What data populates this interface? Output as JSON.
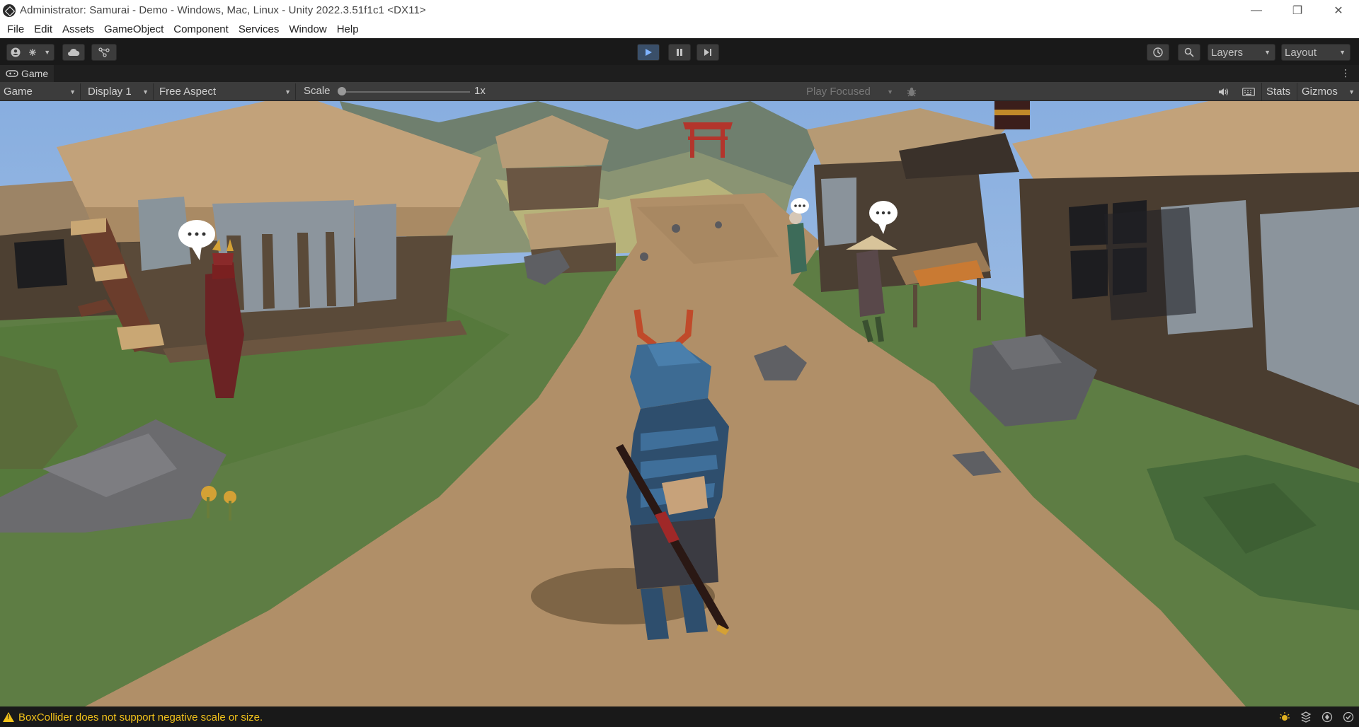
{
  "window": {
    "title": "Administrator: Samurai - Demo - Windows, Mac, Linux - Unity 2022.3.51f1c1 <DX11>",
    "controls": {
      "minimize": "—",
      "maximize": "❐",
      "close": "✕"
    }
  },
  "menu": {
    "items": [
      "File",
      "Edit",
      "Assets",
      "GameObject",
      "Component",
      "Services",
      "Window",
      "Help"
    ]
  },
  "toolbar": {
    "layers_label": "Layers",
    "layout_label": "Layout",
    "play_state": "playing"
  },
  "game_panel": {
    "tab_label": "Game",
    "view_mode": "Game",
    "display": "Display 1",
    "aspect": "Free Aspect",
    "scale_label": "Scale",
    "scale_value": "1x",
    "play_mode": "Play Focused",
    "stats_label": "Stats",
    "gizmos_label": "Gizmos"
  },
  "status": {
    "message": "BoxCollider does not support negative scale or size."
  },
  "colors": {
    "warning": "#f2c21a",
    "play_active_bg": "#3a4f69",
    "editor_bg": "#191919",
    "panel_bg": "#3c3c3c"
  }
}
